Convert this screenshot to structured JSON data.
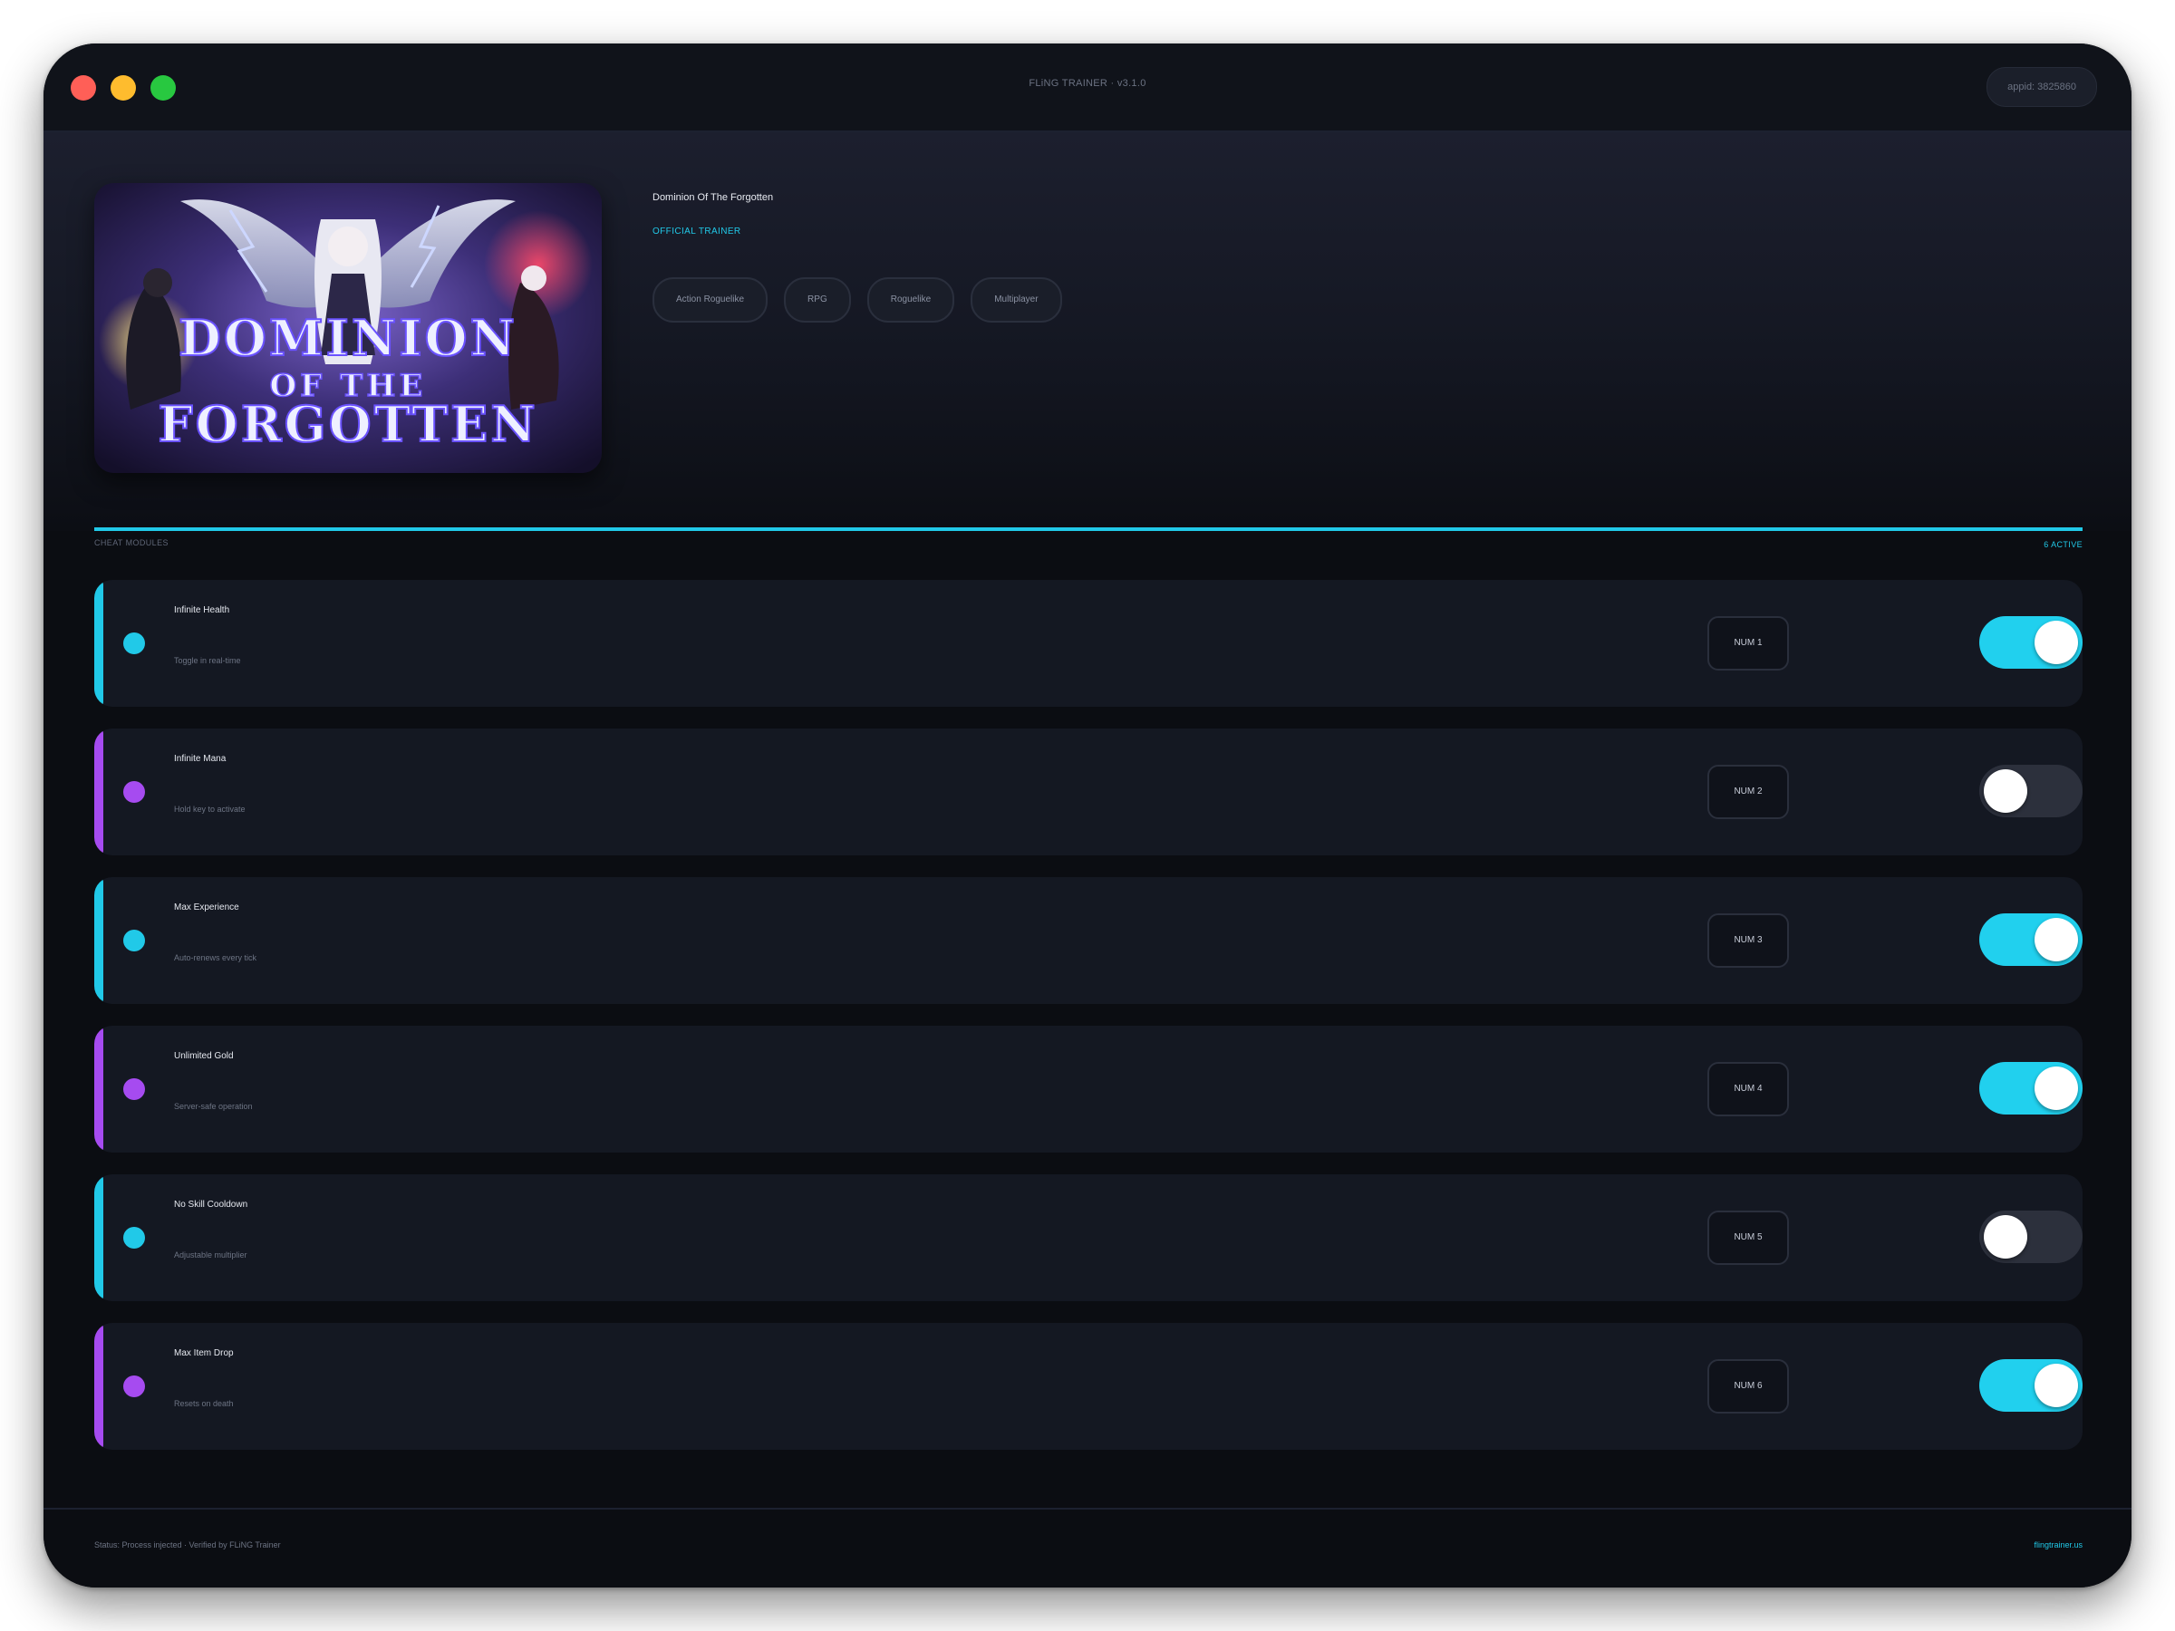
{
  "window": {
    "title": "FLiNG TRAINER · v3.1.0",
    "appid": "appid: 3825860"
  },
  "game": {
    "title": "Dominion Of The Forgotten",
    "subtitle": "OFFICIAL TRAINER",
    "cover_text_line1": "DOMINION",
    "cover_text_line2": "OF THE",
    "cover_text_line3": "FORGOTTEN",
    "tags": [
      "Action Roguelike",
      "RPG",
      "Roguelike",
      "Multiplayer"
    ]
  },
  "section": {
    "label": "CHEAT MODULES",
    "active_count": "6 ACTIVE"
  },
  "cheats": [
    {
      "name": "Infinite Health",
      "desc": "Toggle in real-time",
      "hotkey": "NUM 1",
      "enabled": true,
      "accent": "#21c9e8"
    },
    {
      "name": "Infinite Mana",
      "desc": "Hold key to activate",
      "hotkey": "NUM 2",
      "enabled": false,
      "accent": "#a64bf0"
    },
    {
      "name": "Max Experience",
      "desc": "Auto-renews every tick",
      "hotkey": "NUM 3",
      "enabled": true,
      "accent": "#21c9e8"
    },
    {
      "name": "Unlimited Gold",
      "desc": "Server-safe operation",
      "hotkey": "NUM 4",
      "enabled": true,
      "accent": "#a64bf0"
    },
    {
      "name": "No Skill Cooldown",
      "desc": "Adjustable multiplier",
      "hotkey": "NUM 5",
      "enabled": false,
      "accent": "#21c9e8"
    },
    {
      "name": "Max Item Drop",
      "desc": "Resets on death",
      "hotkey": "NUM 6",
      "enabled": true,
      "accent": "#a64bf0"
    }
  ],
  "footer": {
    "status": "Status: Process injected · Verified by FLiNG Trainer",
    "site": "flingtrainer.us"
  },
  "colors": {
    "accent_cyan": "#21c9e8",
    "accent_purple": "#a64bf0",
    "toggle_on": "#21d0ee",
    "toggle_off": "#2c303c",
    "background": "#0b0d12"
  }
}
